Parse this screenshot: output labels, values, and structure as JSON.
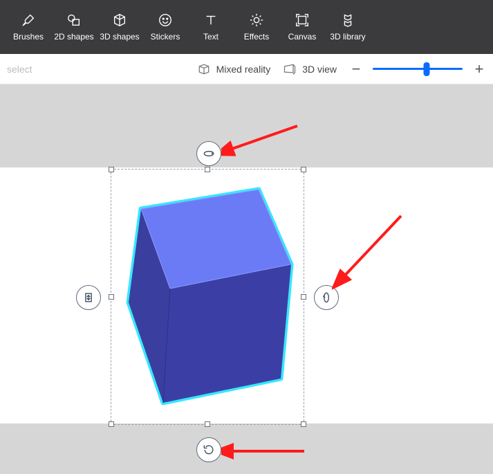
{
  "toolbar": {
    "brushes": "Brushes",
    "shapes2d": "2D shapes",
    "shapes3d": "3D shapes",
    "stickers": "Stickers",
    "text": "Text",
    "effects": "Effects",
    "canvas": "Canvas",
    "library3d": "3D library"
  },
  "viewbar": {
    "select": "select",
    "mixed_reality": "Mixed reality",
    "view3d": "3D view"
  },
  "zoom": {
    "minus": "−",
    "plus": "+",
    "percent": 60
  }
}
